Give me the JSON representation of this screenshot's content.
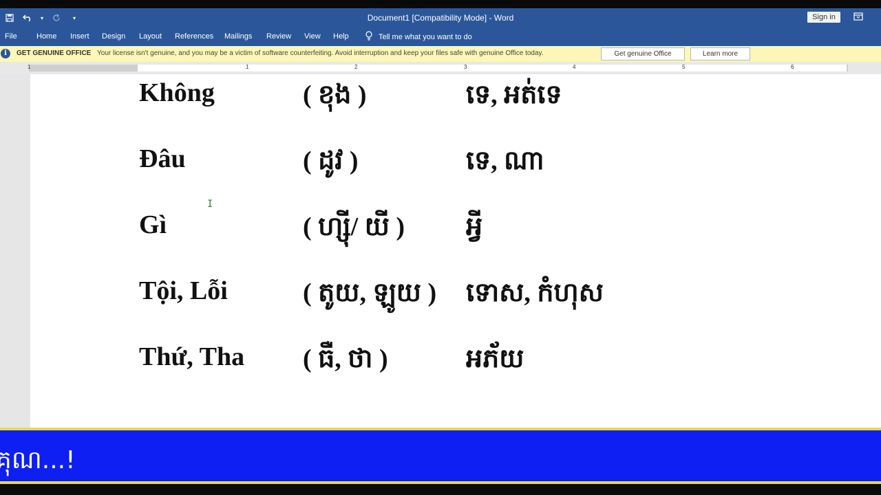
{
  "titlebar": {
    "document_title": "Document1 [Compatibility Mode]  -  Word",
    "sign_in_label": "Sign in"
  },
  "menu": {
    "items": [
      "File",
      "Home",
      "Insert",
      "Design",
      "Layout",
      "References",
      "Mailings",
      "Review",
      "View",
      "Help"
    ],
    "tell_me": "Tell me what you want to do"
  },
  "message_bar": {
    "title": "GET GENUINE OFFICE",
    "text": "Your license isn't genuine, and you may be a victim of software counterfeiting. Avoid interruption and keep your files safe with genuine Office today.",
    "primary_button": "Get genuine Office",
    "secondary_button": "Learn more"
  },
  "ruler": {
    "numbers": [
      "1",
      "1",
      "2",
      "3",
      "4",
      "5",
      "6"
    ]
  },
  "document": {
    "rows": [
      {
        "vietnamese": "Không",
        "pronunciation": "( ខុង )",
        "khmer": "ទេ, អត់ទេ"
      },
      {
        "vietnamese": "Đâu",
        "pronunciation": "( ដូវ )",
        "khmer": "ទេ, ណា"
      },
      {
        "vietnamese": "Gì",
        "pronunciation": "( ហ្សុី/ យី )",
        "khmer": "អ្វី"
      },
      {
        "vietnamese": "Tội, Lỗi",
        "pronunciation": "( តូយ, ឡូយ )",
        "khmer": "ទោស, កំហុស"
      },
      {
        "vietnamese": "Thứ, Tha",
        "pronunciation": "( ធឺ, ថា )",
        "khmer": "អភ័យ"
      }
    ]
  },
  "caption": {
    "text": "គុណ...!"
  },
  "colors": {
    "word_blue": "#2b579a",
    "message_bar": "#fcf7b6",
    "caption_bar": "#0d1ff2",
    "caption_border": "#e8d94a"
  }
}
